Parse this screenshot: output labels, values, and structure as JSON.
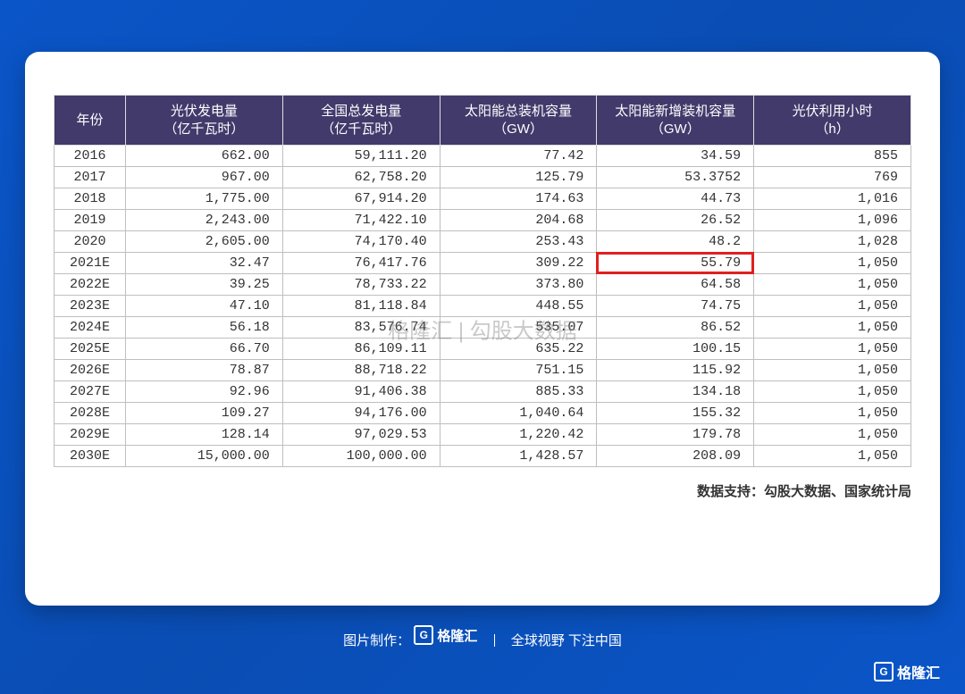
{
  "chart_data": {
    "type": "table",
    "title": "",
    "columns_line1": [
      "年份",
      "光伏发电量",
      "全国总发电量",
      "太阳能总装机容量",
      "太阳能新增装机容量",
      "光伏利用小时"
    ],
    "columns_line2": [
      "",
      "（亿千瓦时）",
      "（亿千瓦时）",
      "（GW）",
      "（GW）",
      "（h）"
    ],
    "highlight_cell": {
      "row": 5,
      "col": 4
    },
    "rows": [
      {
        "year": "2016",
        "c1": "662.00",
        "c2": "59,111.20",
        "c3": "77.42",
        "c4": "34.59",
        "c5": "855"
      },
      {
        "year": "2017",
        "c1": "967.00",
        "c2": "62,758.20",
        "c3": "125.79",
        "c4": "53.3752",
        "c5": "769"
      },
      {
        "year": "2018",
        "c1": "1,775.00",
        "c2": "67,914.20",
        "c3": "174.63",
        "c4": "44.73",
        "c5": "1,016"
      },
      {
        "year": "2019",
        "c1": "2,243.00",
        "c2": "71,422.10",
        "c3": "204.68",
        "c4": "26.52",
        "c5": "1,096"
      },
      {
        "year": "2020",
        "c1": "2,605.00",
        "c2": "74,170.40",
        "c3": "253.43",
        "c4": "48.2",
        "c5": "1,028"
      },
      {
        "year": "2021E",
        "c1": "32.47",
        "c2": "76,417.76",
        "c3": "309.22",
        "c4": "55.79",
        "c5": "1,050"
      },
      {
        "year": "2022E",
        "c1": "39.25",
        "c2": "78,733.22",
        "c3": "373.80",
        "c4": "64.58",
        "c5": "1,050"
      },
      {
        "year": "2023E",
        "c1": "47.10",
        "c2": "81,118.84",
        "c3": "448.55",
        "c4": "74.75",
        "c5": "1,050"
      },
      {
        "year": "2024E",
        "c1": "56.18",
        "c2": "83,576.74",
        "c3": "535.07",
        "c4": "86.52",
        "c5": "1,050"
      },
      {
        "year": "2025E",
        "c1": "66.70",
        "c2": "86,109.11",
        "c3": "635.22",
        "c4": "100.15",
        "c5": "1,050"
      },
      {
        "year": "2026E",
        "c1": "78.87",
        "c2": "88,718.22",
        "c3": "751.15",
        "c4": "115.92",
        "c5": "1,050"
      },
      {
        "year": "2027E",
        "c1": "92.96",
        "c2": "91,406.38",
        "c3": "885.33",
        "c4": "134.18",
        "c5": "1,050"
      },
      {
        "year": "2028E",
        "c1": "109.27",
        "c2": "94,176.00",
        "c3": "1,040.64",
        "c4": "155.32",
        "c5": "1,050"
      },
      {
        "year": "2029E",
        "c1": "128.14",
        "c2": "97,029.53",
        "c3": "1,220.42",
        "c4": "179.78",
        "c5": "1,050"
      },
      {
        "year": "2030E",
        "c1": "15,000.00",
        "c2": "100,000.00",
        "c3": "1,428.57",
        "c4": "208.09",
        "c5": "1,050"
      }
    ]
  },
  "watermark_text": "格隆汇 | 勾股大数据",
  "source_label": "数据支持：勾股大数据、国家统计局",
  "footer": {
    "credit_label": "图片制作：",
    "brand": "格隆汇",
    "tagline": "全球视野 下注中国"
  }
}
